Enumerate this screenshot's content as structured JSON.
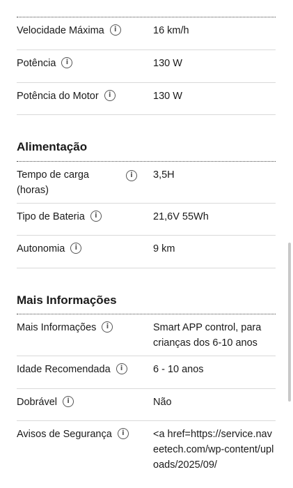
{
  "group1": [
    {
      "label": "Velocidade Máxima",
      "value": "16 km/h"
    },
    {
      "label": "Potência",
      "value": "130 W"
    },
    {
      "label": "Potência do Motor",
      "value": "130 W"
    }
  ],
  "alimentacao": {
    "title": "Alimentação",
    "rows": [
      {
        "label": "Tempo de carga (horas)",
        "value": "3,5H"
      },
      {
        "label": "Tipo de Bateria",
        "value": "21,6V 55Wh"
      },
      {
        "label": "Autonomia",
        "value": "9 km"
      }
    ]
  },
  "mais": {
    "title": "Mais Informações",
    "rows": [
      {
        "label": "Mais Informações",
        "value": "Smart APP control, para crianças dos 6-10 anos"
      },
      {
        "label": "Idade Recomendada",
        "value": "6 - 10 anos"
      },
      {
        "label": "Dobrável",
        "value": "Não"
      },
      {
        "label": "Avisos de Segurança",
        "value": "<a href=https://service.naveetech.com/wp-content/uploads/2025/09/"
      }
    ]
  },
  "info_icon_glyph": "i"
}
